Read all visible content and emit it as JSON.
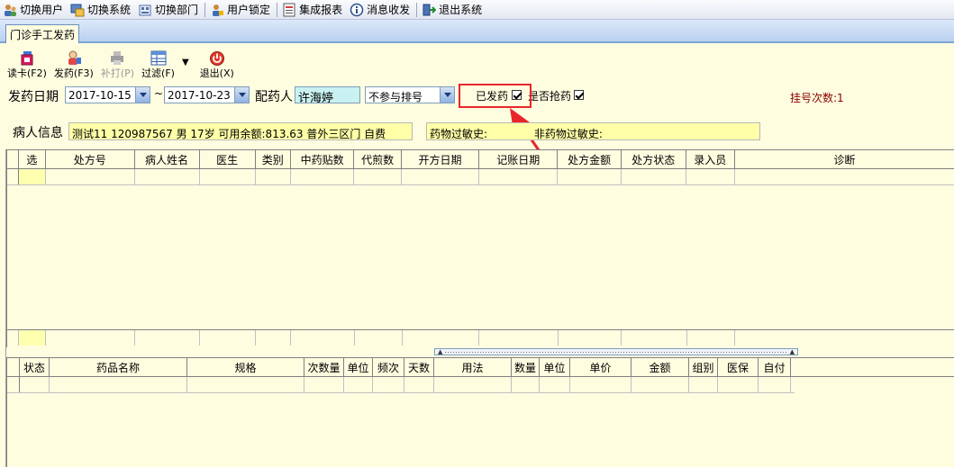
{
  "menu": {
    "items": [
      {
        "label": "切换用户",
        "icon": "users-switch-icon"
      },
      {
        "label": "切换系统",
        "icon": "system-switch-icon"
      },
      {
        "label": "切换部门",
        "icon": "department-switch-icon"
      },
      {
        "label": "用户锁定",
        "icon": "user-lock-icon"
      },
      {
        "label": "集成报表",
        "icon": "report-icon"
      },
      {
        "label": "消息收发",
        "icon": "message-icon"
      },
      {
        "label": "退出系统",
        "icon": "exit-system-icon"
      }
    ]
  },
  "tab": {
    "label": "门诊手工发药"
  },
  "toolbar": {
    "read_card": "读卡(F2)",
    "dispense": "发药(F3)",
    "reprint": "补打(P)",
    "filter": "过滤(F)",
    "exit": "退出(X)"
  },
  "filter": {
    "date_label": "发药日期",
    "date_from": "2017-10-15",
    "tilde": "~",
    "date_to": "2017-10-23",
    "pharmacist_label": "配药人",
    "pharmacist_value": "许海婷",
    "queue_option": "不参与排号",
    "dispensed_label": "已发药",
    "grab_label": "是否抢药",
    "register_count": "挂号次数:1"
  },
  "patient": {
    "label": "病人信息",
    "info": "测试11 120987567 男 17岁 可用余额:813.63 普外三区门 自费",
    "allergy_label": "药物过敏史:",
    "non_drug_allergy_label": "非药物过敏史:"
  },
  "grid_top": {
    "columns": [
      "选",
      "处方号",
      "病人姓名",
      "医生",
      "类别",
      "中药贴数",
      "代煎数",
      "开方日期",
      "记账日期",
      "处方金额",
      "处方状态",
      "录入员",
      "诊断"
    ]
  },
  "grid_bottom": {
    "columns": [
      "状态",
      "药品名称",
      "规格",
      "次数量",
      "单位",
      "频次",
      "天数",
      "用法",
      "数量",
      "单位",
      "单价",
      "金额",
      "组别",
      "医保",
      "自付"
    ]
  },
  "colors": {
    "highlight": "#e8262a",
    "background": "#fffde0",
    "patient_box": "#ffffa8"
  }
}
